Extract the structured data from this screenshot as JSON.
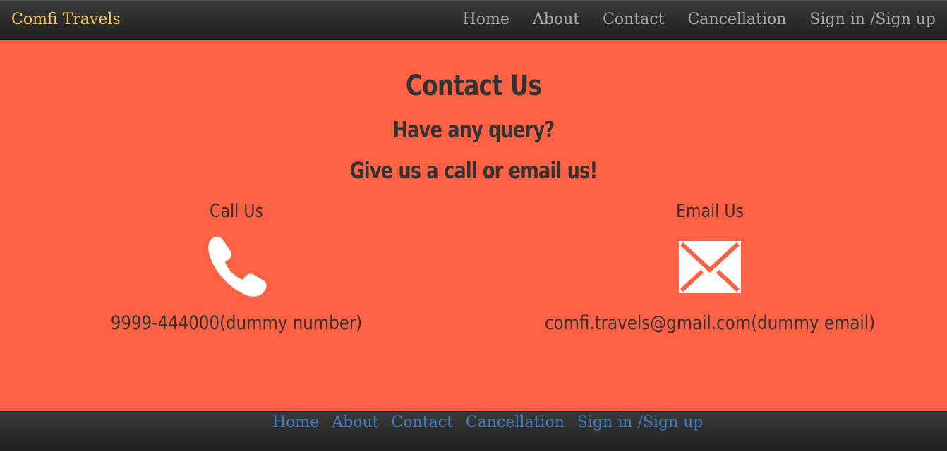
{
  "header": {
    "brand": "Comfi Travels",
    "nav": [
      "Home",
      "About",
      "Contact",
      "Cancellation",
      "Sign in /Sign up"
    ]
  },
  "main": {
    "title": "Contact Us",
    "subtitle": "Have any query?",
    "tagline": "Give us a call or email us!",
    "call": {
      "heading": "Call Us",
      "icon": "phone-icon",
      "value": "9999-444000(dummy number)"
    },
    "email": {
      "heading": "Email Us",
      "icon": "envelope-icon",
      "value": "comfi.travels@gmail.com(dummy email)"
    }
  },
  "footer": {
    "nav": [
      "Home",
      "About",
      "Contact",
      "Cancellation",
      "Sign in /Sign up"
    ]
  },
  "colors": {
    "background": "#ff6145",
    "brand": "#f7c94a",
    "footer_link": "#3d7dc4"
  }
}
